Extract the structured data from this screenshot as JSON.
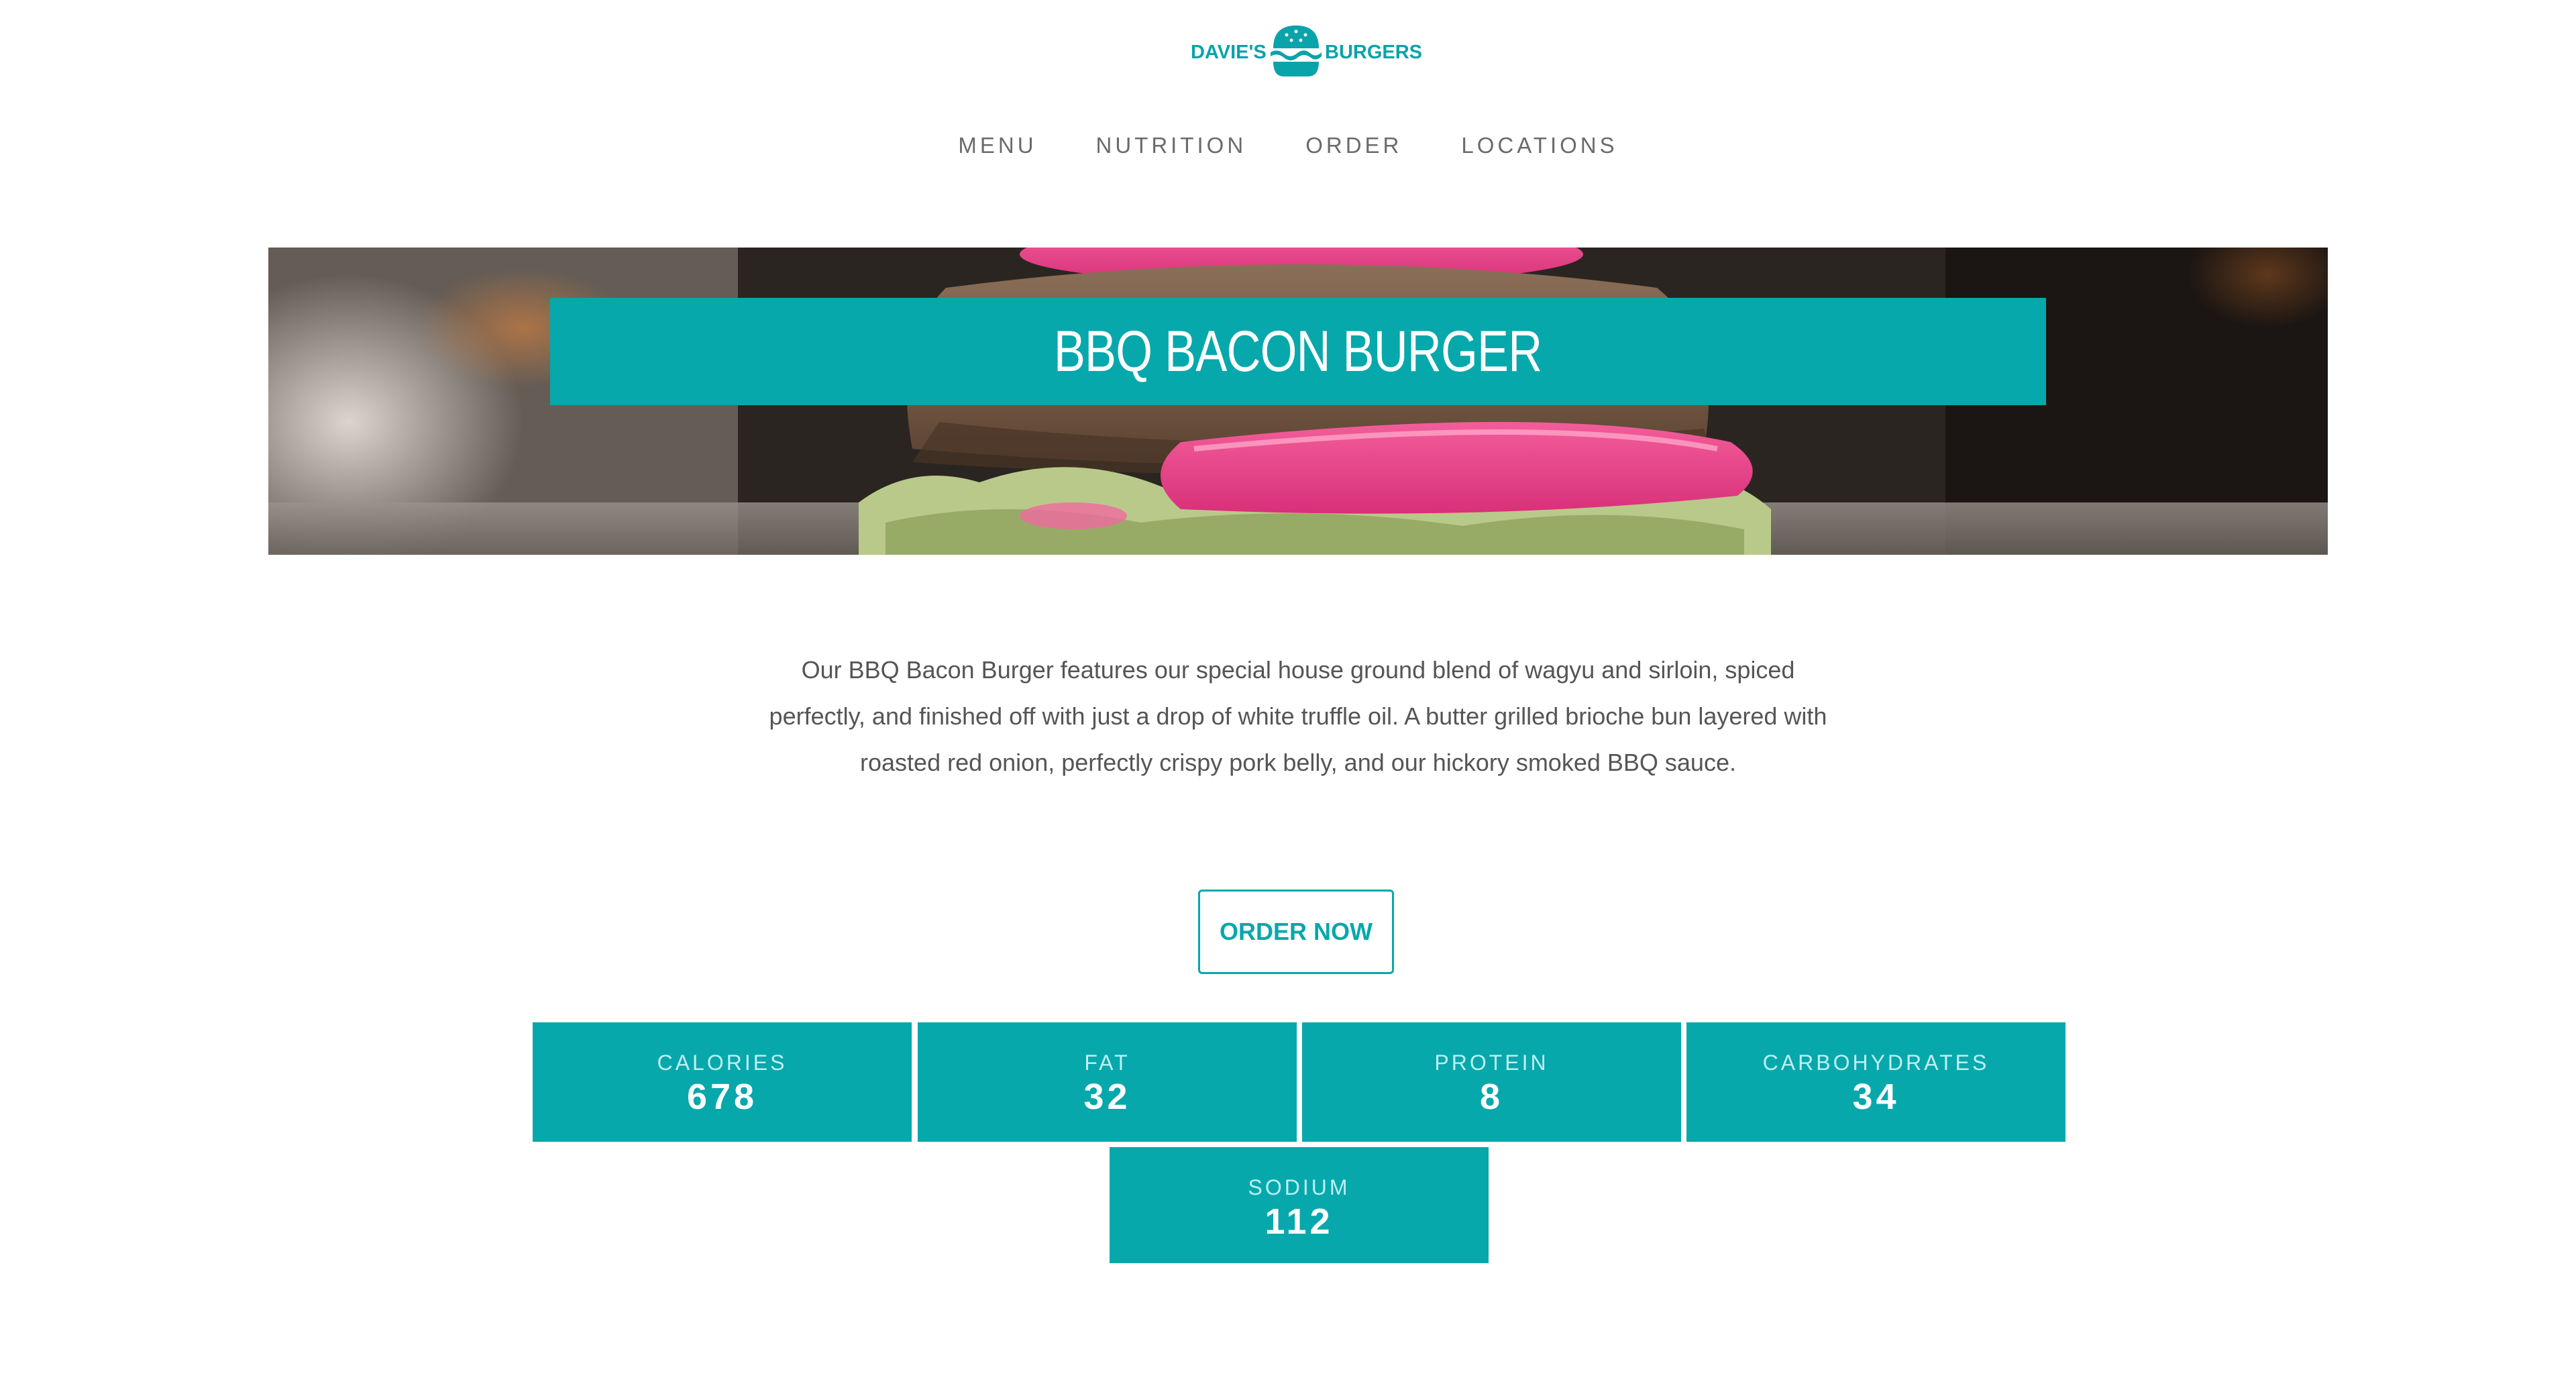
{
  "brand": {
    "name_left": "DAVIE'S",
    "name_right": "BURGERS",
    "color": "#0aa3aa"
  },
  "nav": {
    "items": [
      "MENU",
      "NUTRITION",
      "ORDER",
      "LOCATIONS"
    ]
  },
  "hero": {
    "title": "BBQ BACON BURGER"
  },
  "description": "Our BBQ Bacon Burger features our special house ground blend of wagyu and sirloin, spiced perfectly, and finished off with just a drop of white truffle oil. A butter grilled brioche bun layered with roasted red onion, perfectly crispy pork belly, and our hickory smoked BBQ sauce.",
  "order_button": {
    "label": "ORDER NOW"
  },
  "nutrition": [
    {
      "label": "CALORIES",
      "value": "678"
    },
    {
      "label": "FAT",
      "value": "32"
    },
    {
      "label": "PROTEIN",
      "value": "8"
    },
    {
      "label": "CARBOHYDRATES",
      "value": "34"
    },
    {
      "label": "SODIUM",
      "value": "112"
    }
  ],
  "colors": {
    "accent": "#06a8ac",
    "text": "#555555",
    "nav_text": "#6a6a6a"
  }
}
